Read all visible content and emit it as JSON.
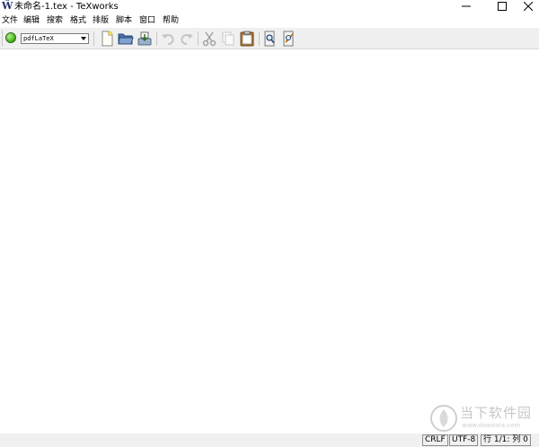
{
  "window": {
    "title": "未命名-1.tex - TeXworks",
    "app_icon_glyph": "Ŵ"
  },
  "menu": [
    "文件",
    "编辑",
    "搜索",
    "格式",
    "排版",
    "脚本",
    "窗口",
    "帮助"
  ],
  "toolbar": {
    "engine": "pdfLaTeX",
    "typeset_color": "#4fb81f",
    "buttons": [
      "new-file-icon",
      "open-file-icon",
      "save-icon",
      "undo-icon",
      "redo-icon",
      "cut-icon",
      "copy-icon",
      "paste-icon",
      "find-icon",
      "replace-icon"
    ]
  },
  "editor": {
    "content": ""
  },
  "status": {
    "line_ending": "CRLF",
    "encoding": "UTF-8",
    "position": "行 1/1: 列 0"
  },
  "watermark": {
    "title": "当下软件园",
    "url": "www.downxia.com"
  }
}
